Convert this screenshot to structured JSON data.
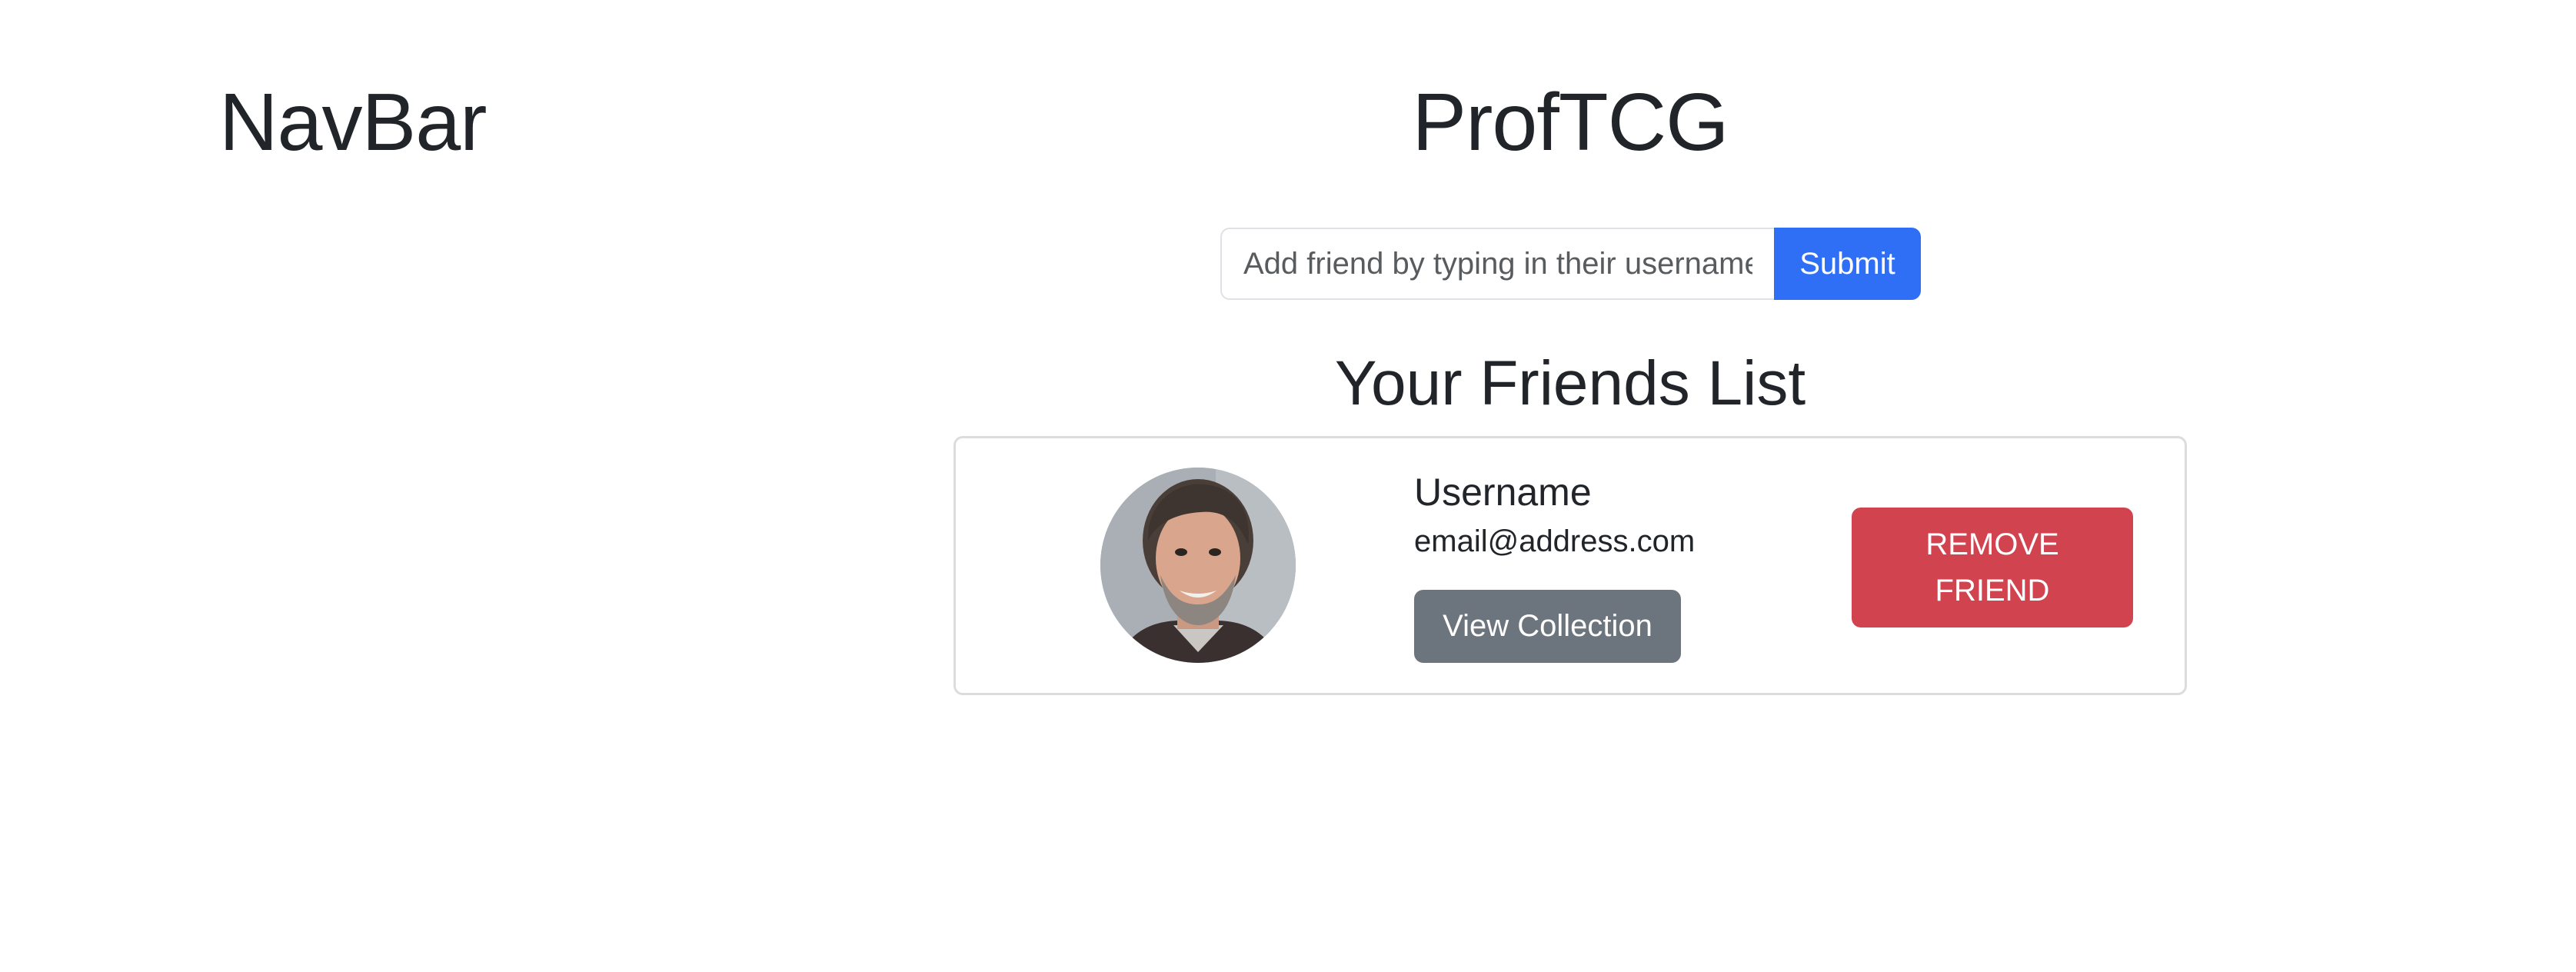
{
  "navbar": {
    "title": "NavBar"
  },
  "app": {
    "title": "ProfTCG"
  },
  "add_friend": {
    "placeholder": "Add friend by typing in their username",
    "value": "",
    "submit_label": "Submit"
  },
  "friends_list": {
    "heading": "Your Friends List",
    "friends": [
      {
        "username": "Username",
        "email": "email@address.com",
        "view_label": "View Collection",
        "remove_label": "REMOVE FRIEND"
      }
    ]
  },
  "colors": {
    "primary": "#2f6ff6",
    "secondary": "#6c757d",
    "danger": "#d1434f",
    "text": "#212529",
    "border": "#dcdcdc"
  }
}
